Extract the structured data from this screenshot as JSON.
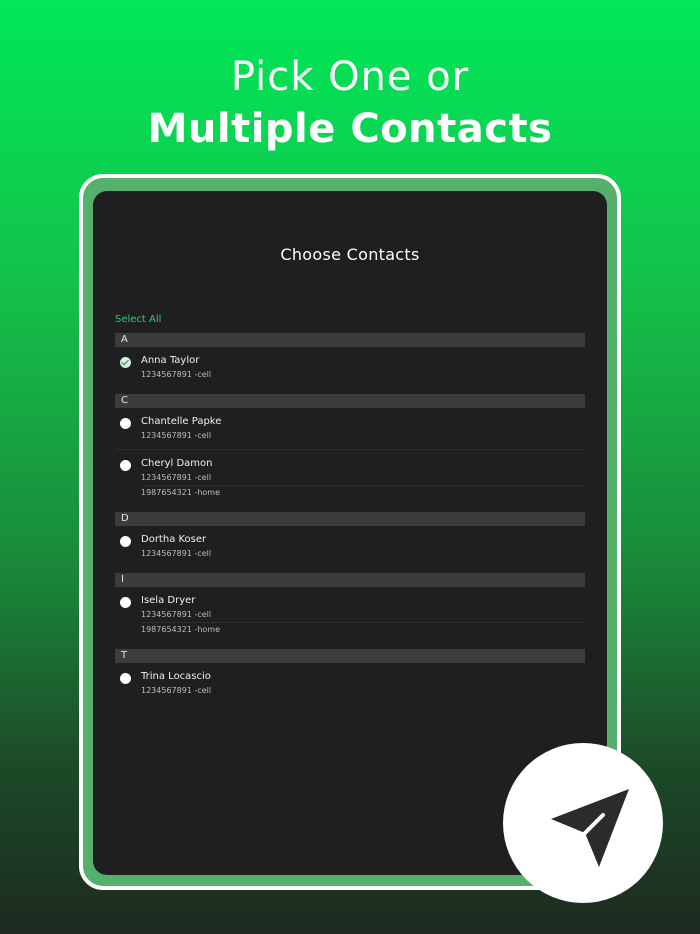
{
  "headline": {
    "line1": "Pick One or",
    "line2": "Multiple Contacts"
  },
  "screen": {
    "title": "Choose Contacts",
    "select_all": "Select All"
  },
  "sections": [
    {
      "letter": "A",
      "contacts": [
        {
          "name": "Anna Taylor",
          "checked": true,
          "phones": [
            "1234567891 -cell"
          ]
        }
      ]
    },
    {
      "letter": "C",
      "contacts": [
        {
          "name": "Chantelle Papke",
          "checked": false,
          "phones": [
            "1234567891 -cell"
          ]
        },
        {
          "name": "Cheryl Damon",
          "checked": false,
          "phones": [
            "1234567891 -cell",
            "1987654321 -home"
          ]
        }
      ]
    },
    {
      "letter": "D",
      "contacts": [
        {
          "name": "Dortha Koser",
          "checked": false,
          "phones": [
            "1234567891 -cell"
          ]
        }
      ]
    },
    {
      "letter": "I",
      "contacts": [
        {
          "name": "Isela Dryer",
          "checked": false,
          "phones": [
            "1234567891 -cell",
            "1987654321 -home"
          ]
        }
      ]
    },
    {
      "letter": "T",
      "contacts": [
        {
          "name": "Trina Locascio",
          "checked": false,
          "phones": [
            "1234567891 -cell"
          ]
        }
      ]
    }
  ],
  "icons": {
    "send": "send-icon",
    "check": "check-icon"
  },
  "colors": {
    "accent": "#2ecc71",
    "screen_bg": "#1f1f21",
    "section_bg": "#3c3c3e",
    "fab_icon": "#2b2b2d"
  }
}
